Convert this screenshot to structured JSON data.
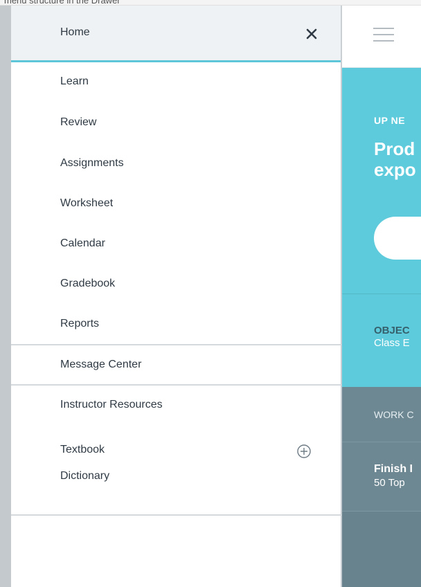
{
  "top_strip_text": "menu structure in the Drawer",
  "drawer": {
    "header_label": "Home",
    "items": [
      {
        "label": "Learn"
      },
      {
        "label": "Review"
      },
      {
        "label": "Assignments"
      },
      {
        "label": "Worksheet"
      },
      {
        "label": "Calendar"
      },
      {
        "label": "Gradebook"
      },
      {
        "label": "Reports"
      },
      {
        "label": "Message Center"
      },
      {
        "label": "Instructor Resources"
      },
      {
        "label": "Textbook"
      },
      {
        "label": "Dictionary"
      }
    ]
  },
  "main": {
    "up_next_eyebrow": "UP NE",
    "up_next_title_line1": "Prod",
    "up_next_title_line2": "expo",
    "objectives_heading": "OBJEC",
    "objectives_sub": "Class E",
    "work_heading": "WORK C",
    "task_title": "Finish I",
    "task_sub": "50 Top"
  },
  "colors": {
    "accent": "#5dc6d8",
    "teal_panel": "#5ecbdc",
    "slate_panel": "#6e8893",
    "text_dark": "#2f3a44"
  }
}
